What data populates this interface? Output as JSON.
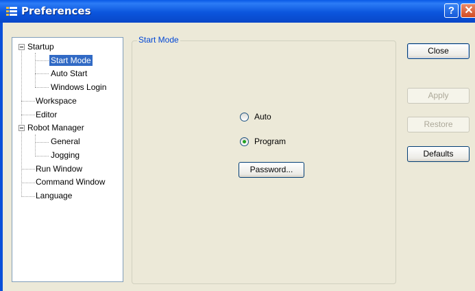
{
  "window": {
    "title": "Preferences",
    "help_glyph": "?",
    "close_glyph": "✕"
  },
  "tree": {
    "items": [
      {
        "label": "Startup",
        "expander": "minus"
      },
      {
        "label": "Start Mode",
        "selected": true
      },
      {
        "label": "Auto Start"
      },
      {
        "label": "Windows Login"
      },
      {
        "label": "Workspace"
      },
      {
        "label": "Editor"
      },
      {
        "label": "Robot Manager",
        "expander": "minus"
      },
      {
        "label": "General"
      },
      {
        "label": "Jogging"
      },
      {
        "label": "Run Window"
      },
      {
        "label": "Command Window"
      },
      {
        "label": "Language"
      }
    ]
  },
  "panel": {
    "legend": "Start Mode",
    "options": [
      {
        "label": "Auto",
        "selected": false
      },
      {
        "label": "Program",
        "selected": true
      }
    ],
    "password_button": "Password..."
  },
  "buttons": {
    "close": "Close",
    "apply": "Apply",
    "restore": "Restore",
    "defaults": "Defaults"
  },
  "colors": {
    "titlebar": "#0a5ae6",
    "selection": "#316ac5",
    "legend_text": "#0046d5",
    "face": "#ece9d8"
  }
}
